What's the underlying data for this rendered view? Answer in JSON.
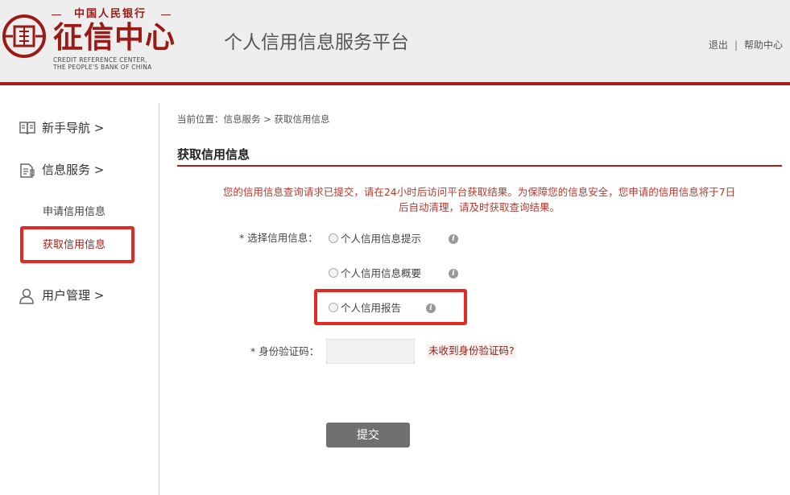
{
  "header": {
    "logo_top": "中国人民银行",
    "logo_main": "征信中心",
    "logo_en_line1": "CREDIT REFERENCE CENTER,",
    "logo_en_line2": "THE PEOPLE'S BANK OF CHINA",
    "site_title": "个人信用信息服务平台",
    "nav": {
      "logout": "退出",
      "separator": "|",
      "help": "帮助中心"
    }
  },
  "sidebar": {
    "items": [
      {
        "label": "新手导航 >",
        "icon": "book-icon"
      },
      {
        "label": "信息服务 >",
        "icon": "document-icon"
      },
      {
        "label": "用户管理 >",
        "icon": "user-icon"
      }
    ],
    "sub_items": [
      {
        "label": "申请信用信息",
        "active": false
      },
      {
        "label": "获取信用信息",
        "active": true
      }
    ]
  },
  "breadcrumb": "当前位置：信息服务 > 获取信用信息",
  "section_title": "获取信用信息",
  "notice": {
    "line1": "您的信用信息查询请求已提交，请在24小时后访问平台获取结果。为保障您的信息安全，您申请的信用信息将于7日",
    "line2": "后自动清理，请及时获取查询结果。"
  },
  "form": {
    "select_label": "* 选择信用信息：",
    "options": [
      {
        "label": "个人信用信息提示",
        "selected": false
      },
      {
        "label": "个人信用信息概要",
        "selected": false
      },
      {
        "label": "个人信用报告",
        "selected": false
      }
    ],
    "info_icon_glyph": "i",
    "code_label": "* 身份验证码：",
    "code_value": "",
    "code_link": "未收到身份验证码?",
    "submit_label": "提交"
  },
  "colors": {
    "brand_red": "#a51e1b",
    "highlight_red": "#e02a23",
    "notice_text": "#b8392f",
    "button_gray": "#707070",
    "header_bg": "#eeeeee"
  }
}
